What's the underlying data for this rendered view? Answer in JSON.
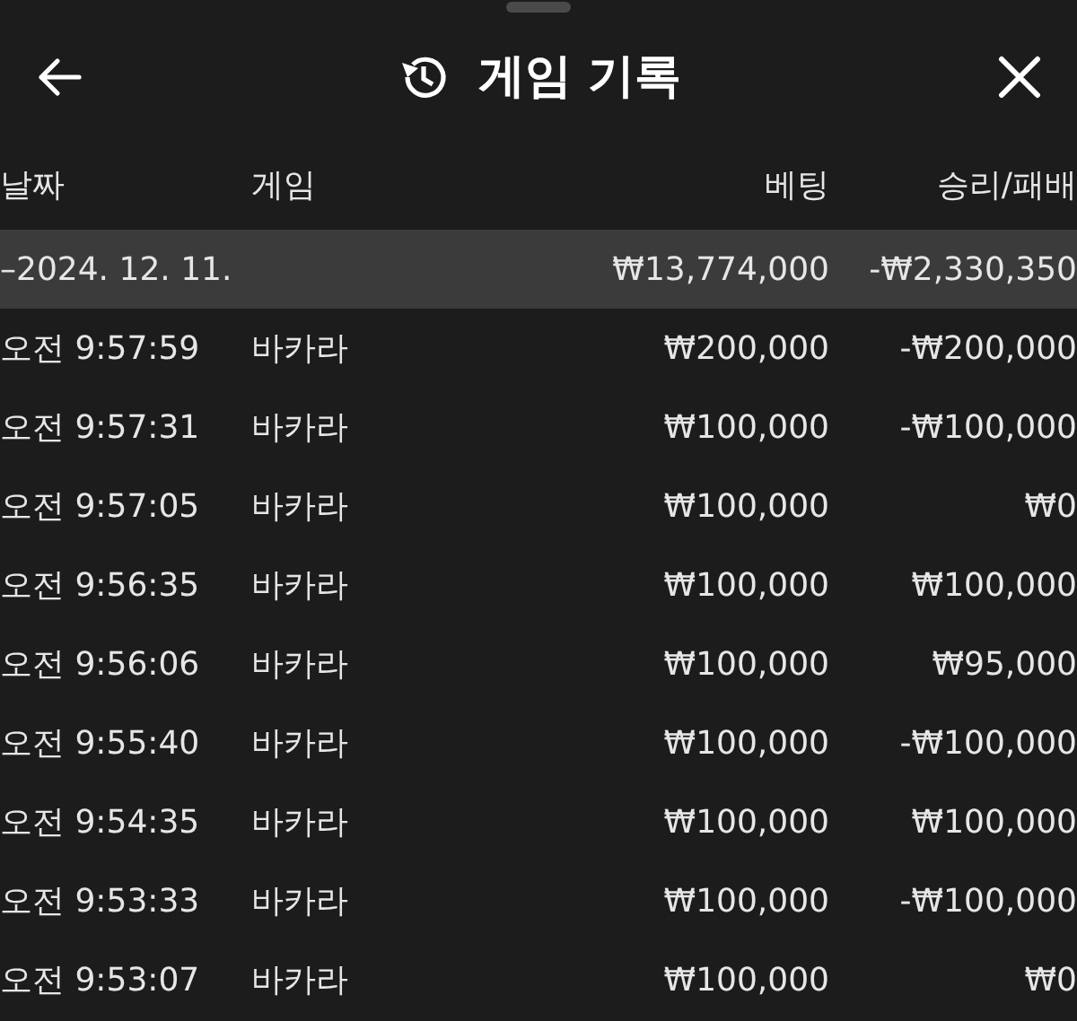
{
  "header": {
    "title": "게임 기록"
  },
  "table": {
    "columns": [
      "날짜",
      "게임",
      "베팅",
      "승리/패배"
    ],
    "group": {
      "date": "–2024. 12. 11.",
      "bet": "₩13,774,000",
      "result": "-₩2,330,350"
    },
    "rows": [
      {
        "time": "오전 9:57:59",
        "game": "바카라",
        "bet": "₩200,000",
        "result": "-₩200,000"
      },
      {
        "time": "오전 9:57:31",
        "game": "바카라",
        "bet": "₩100,000",
        "result": "-₩100,000"
      },
      {
        "time": "오전 9:57:05",
        "game": "바카라",
        "bet": "₩100,000",
        "result": "₩0"
      },
      {
        "time": "오전 9:56:35",
        "game": "바카라",
        "bet": "₩100,000",
        "result": "₩100,000"
      },
      {
        "time": "오전 9:56:06",
        "game": "바카라",
        "bet": "₩100,000",
        "result": "₩95,000"
      },
      {
        "time": "오전 9:55:40",
        "game": "바카라",
        "bet": "₩100,000",
        "result": "-₩100,000"
      },
      {
        "time": "오전 9:54:35",
        "game": "바카라",
        "bet": "₩100,000",
        "result": "₩100,000"
      },
      {
        "time": "오전 9:53:33",
        "game": "바카라",
        "bet": "₩100,000",
        "result": "-₩100,000"
      },
      {
        "time": "오전 9:53:07",
        "game": "바카라",
        "bet": "₩100,000",
        "result": "₩0"
      }
    ]
  }
}
